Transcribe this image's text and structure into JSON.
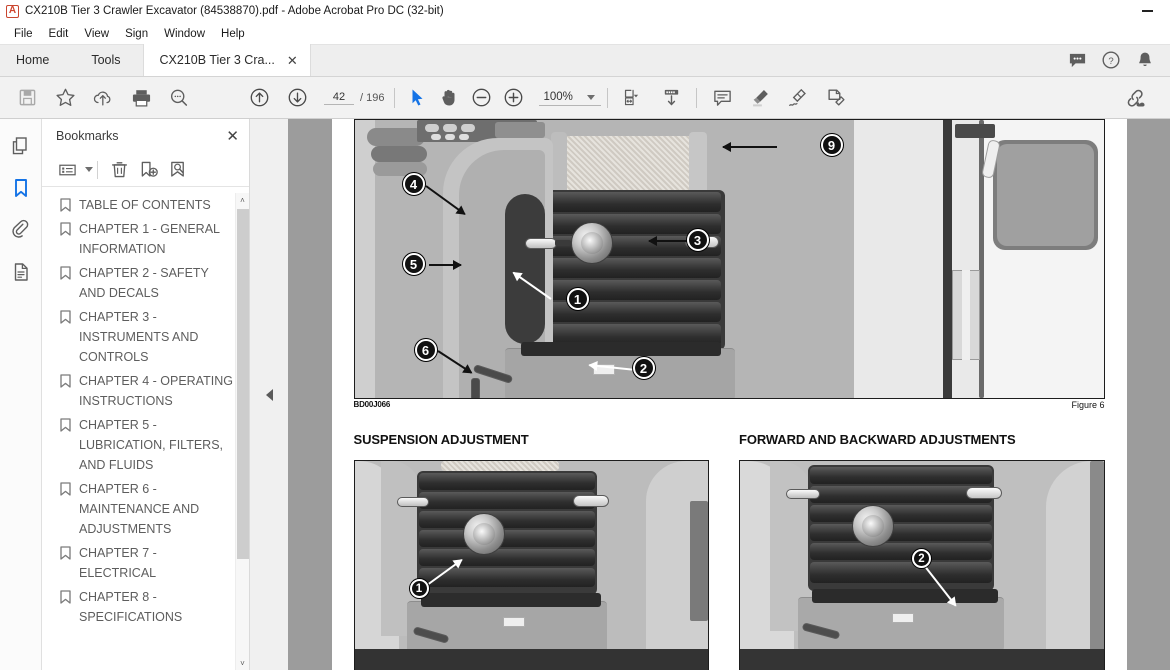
{
  "window": {
    "title": "CX210B Tier 3 Crawler Excavator (84538870).pdf - Adobe Acrobat Pro DC (32-bit)",
    "app_icon": "acrobat-icon",
    "minimize_label": "–"
  },
  "menubar": {
    "items": [
      {
        "label": "File"
      },
      {
        "label": "Edit"
      },
      {
        "label": "View"
      },
      {
        "label": "Sign"
      },
      {
        "label": "Window"
      },
      {
        "label": "Help"
      }
    ]
  },
  "tabbar": {
    "home_label": "Home",
    "tools_label": "Tools",
    "document_tab": {
      "label": "CX210B Tier 3 Cra...",
      "close_label": "✕"
    },
    "right_icons": [
      {
        "name": "chat-icon"
      },
      {
        "name": "help-icon"
      },
      {
        "name": "notification-bell-icon"
      }
    ]
  },
  "toolbar": {
    "left_icons": [
      {
        "name": "save-icon"
      },
      {
        "name": "star-icon"
      },
      {
        "name": "upload-cloud-icon"
      },
      {
        "name": "print-icon"
      },
      {
        "name": "search-icon"
      }
    ],
    "page_up_icon": "page-up-icon",
    "page_down_icon": "page-down-icon",
    "page_number": "42",
    "page_total": "/ 196",
    "select_tool_icon": "select-cursor-icon",
    "hand_tool_icon": "hand-tool-icon",
    "zoom_out_icon": "zoom-out-icon",
    "zoom_in_icon": "zoom-in-icon",
    "zoom_value": "100%",
    "fit_page_icon": "fit-page-icon",
    "scroll_mode_icon": "scroll-mode-icon",
    "comment_icon": "comment-icon",
    "highlight_icon": "highlight-icon",
    "draw_icon": "draw-icon",
    "fill-sign_icon": "fill-and-sign-icon",
    "share_icon": "share-link-icon"
  },
  "rail": {
    "items": [
      {
        "name": "page-thumbnails-icon",
        "active": false
      },
      {
        "name": "bookmarks-icon",
        "active": true
      },
      {
        "name": "attachments-icon",
        "active": false
      },
      {
        "name": "document-properties-icon",
        "active": false
      }
    ]
  },
  "bookmarks_panel": {
    "title": "Bookmarks",
    "close_label": "✕",
    "tools": [
      {
        "name": "bookmark-options-icon"
      },
      {
        "name": "delete-bookmark-icon"
      },
      {
        "name": "new-bookmark-icon"
      },
      {
        "name": "find-bookmark-icon"
      }
    ],
    "items": [
      {
        "label": "TABLE OF CONTENTS"
      },
      {
        "label": "CHAPTER 1 - GENERAL INFORMATION"
      },
      {
        "label": "CHAPTER 2 - SAFETY AND DECALS"
      },
      {
        "label": "CHAPTER 3 - INSTRUMENTS AND CONTROLS"
      },
      {
        "label": "CHAPTER 4 - OPERATING INSTRUCTIONS"
      },
      {
        "label": "CHAPTER 5 - LUBRICATION, FILTERS, AND FLUIDS"
      },
      {
        "label": "CHAPTER 6 - MAINTENANCE AND ADJUSTMENTS"
      },
      {
        "label": "CHAPTER 7 - ELECTRICAL"
      },
      {
        "label": "CHAPTER 8 - SPECIFICATIONS"
      }
    ],
    "scroll_up_label": "˄",
    "scroll_down_label": "˅"
  },
  "gutter": {
    "collapse_icon": "collapse-panel-arrow-icon"
  },
  "document": {
    "main_figure": {
      "image_code": "BD00J066",
      "figure_label": "Figure 6",
      "callouts": [
        {
          "number": "1"
        },
        {
          "number": "2"
        },
        {
          "number": "3"
        },
        {
          "number": "4"
        },
        {
          "number": "5"
        },
        {
          "number": "6"
        },
        {
          "number": "9"
        }
      ]
    },
    "sections": [
      {
        "title": "SUSPENSION ADJUSTMENT",
        "callouts": [
          {
            "number": "1"
          }
        ]
      },
      {
        "title": "FORWARD AND BACKWARD ADJUSTMENTS",
        "callouts": [
          {
            "number": "2"
          }
        ]
      }
    ]
  },
  "colors": {
    "accent": "#1473e6",
    "toolbar_bg": "#f2f2f2",
    "tabbar_bg": "#eeeeee",
    "viewport_bg": "#9c9c9c"
  }
}
